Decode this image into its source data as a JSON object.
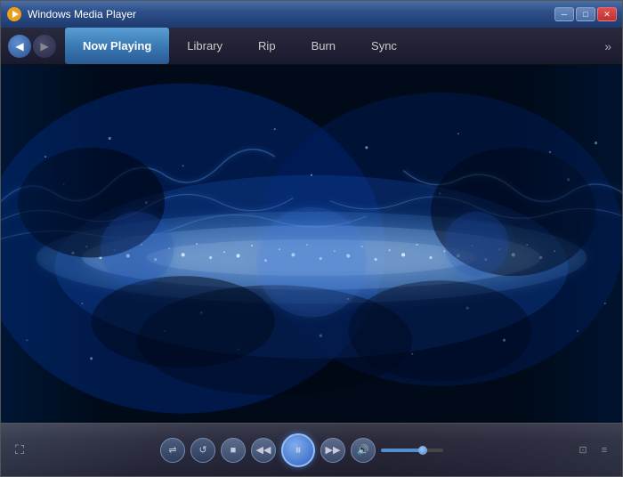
{
  "window": {
    "title": "Windows Media Player",
    "icon": "▶"
  },
  "titlebar": {
    "minimize_label": "─",
    "maximize_label": "□",
    "close_label": "✕"
  },
  "navbar": {
    "back_label": "◀",
    "forward_label": "▶",
    "tabs": [
      {
        "id": "now-playing",
        "label": "Now Playing",
        "active": true
      },
      {
        "id": "library",
        "label": "Library",
        "active": false
      },
      {
        "id": "rip",
        "label": "Rip",
        "active": false
      },
      {
        "id": "burn",
        "label": "Burn",
        "active": false
      },
      {
        "id": "sync",
        "label": "Sync",
        "active": false
      }
    ],
    "more_label": "»"
  },
  "controls": {
    "fullscreen_label": "⛶",
    "shuffle_label": "⇌",
    "repeat_label": "↺",
    "stop_label": "■",
    "prev_label": "◀◀",
    "play_pause_label": "⏸",
    "next_label": "▶▶",
    "volume_icon_label": "🔊",
    "volume_value": 70,
    "mini_restore_label": "⊡",
    "mini_equalize_label": "≡"
  },
  "visualization": {
    "type": "fractal_blue",
    "description": "Blue fractal particle visualization"
  }
}
